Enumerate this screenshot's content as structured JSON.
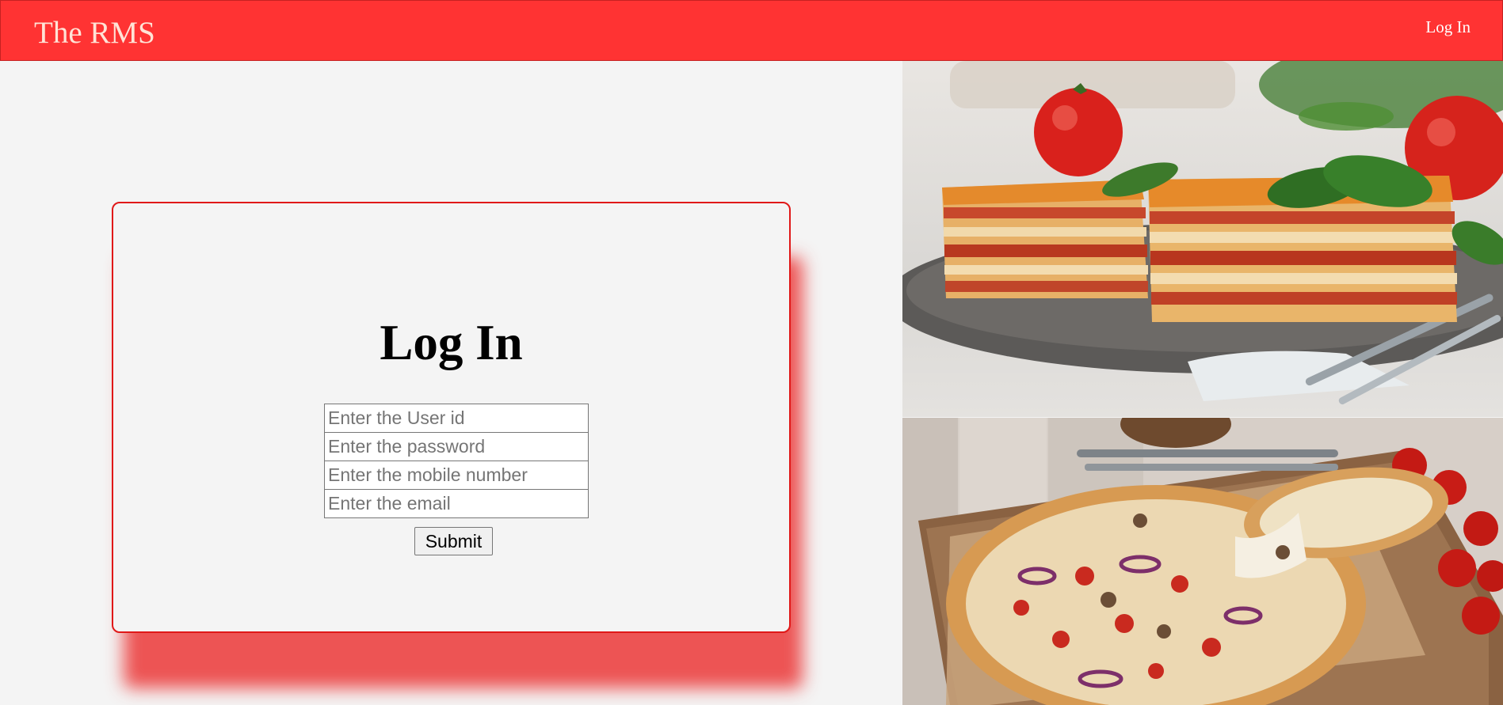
{
  "navbar": {
    "brand": "The RMS",
    "login_link": "Log In",
    "background": "#ff3333"
  },
  "login_card": {
    "title": "Log In",
    "border_color": "#e01818",
    "fields": {
      "user_id_placeholder": "Enter the User id",
      "password_placeholder": "Enter the password",
      "mobile_placeholder": "Enter the mobile number",
      "email_placeholder": "Enter the email"
    },
    "submit_label": "Submit"
  },
  "images": {
    "top": "lasagna-photo",
    "bottom": "pizza-photo"
  }
}
